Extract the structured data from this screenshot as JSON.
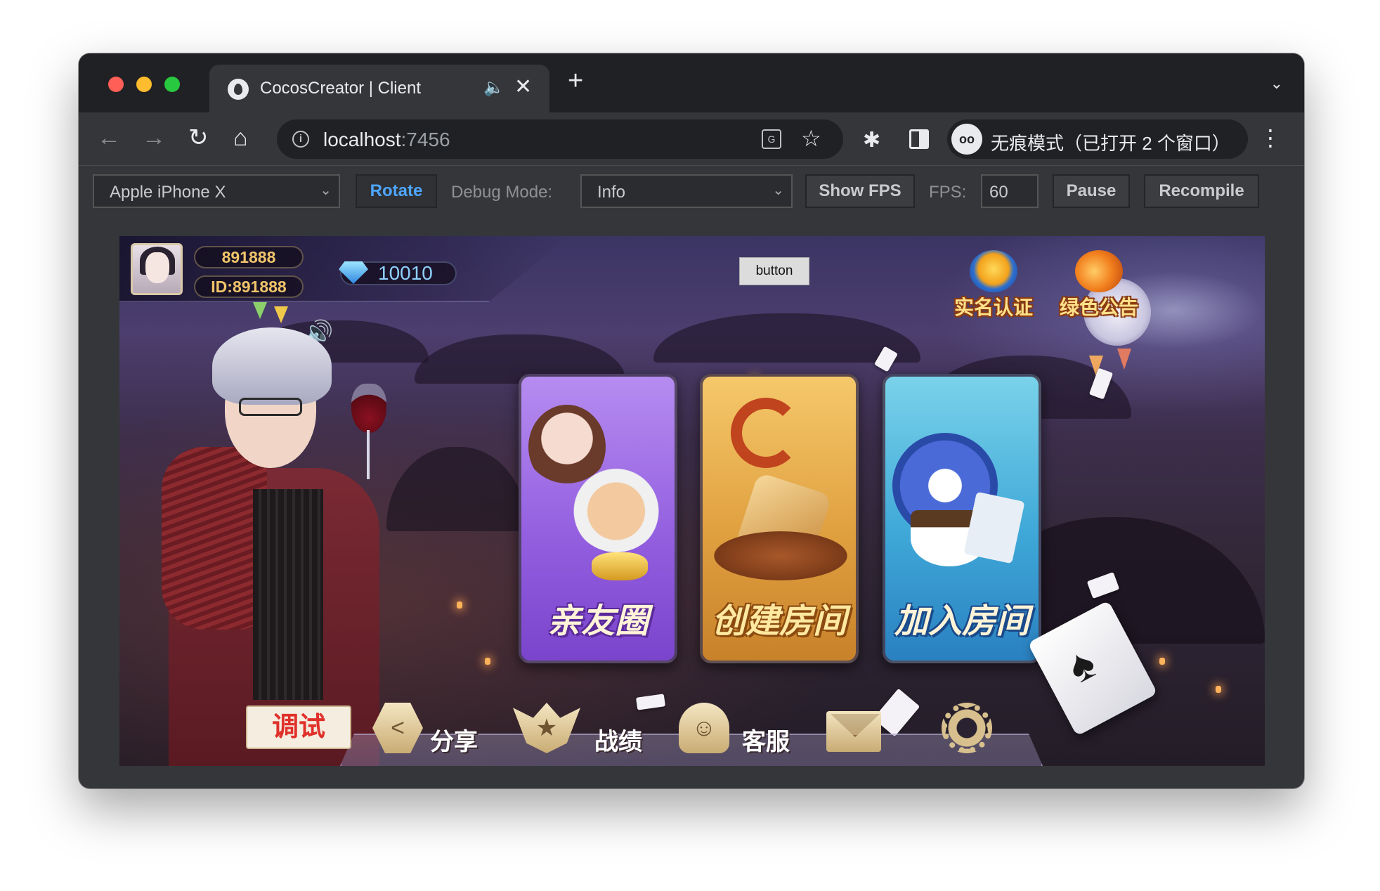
{
  "browser": {
    "tab": {
      "title": "CocosCreator | Client",
      "audio_icon": "speaker-icon",
      "close_glyph": "✕"
    },
    "new_tab_glyph": "+",
    "tab_menu_glyph": "⌄",
    "nav": {
      "back_glyph": "←",
      "forward_glyph": "→",
      "reload_glyph": "↻",
      "home_glyph": "⌂"
    },
    "address": {
      "host": "localhost",
      "port": ":7456"
    },
    "translate_glyph": "G",
    "bookmark_glyph": "☆",
    "extensions_glyph": "✱",
    "incognito_label": "无痕模式（已打开 2 个窗口）",
    "incognito_glyph": "oo",
    "more_glyph": "⋮"
  },
  "devbar": {
    "device_select": "Apple iPhone X",
    "rotate_label": "Rotate",
    "debug_mode_label": "Debug Mode:",
    "debug_mode_value": "Info",
    "show_fps_label": "Show FPS",
    "fps_label": "FPS:",
    "fps_value": "60",
    "pause_label": "Pause",
    "recompile_label": "Recompile",
    "chevron_glyph": "⌄"
  },
  "game": {
    "player": {
      "coins": "891888",
      "id": "ID:891888",
      "diamonds": "10010"
    },
    "sound_glyph": "🔊",
    "debug_button_label": "button",
    "top_icons": [
      {
        "label": "实名认证",
        "icon": "verify-medal-icon"
      },
      {
        "label": "绿色公告",
        "icon": "megaphone-icon"
      }
    ],
    "cards": [
      {
        "label": "亲友圈",
        "color": "#9460e0"
      },
      {
        "label": "创建房间",
        "color": "#e0a040"
      },
      {
        "label": "加入房间",
        "color": "#3fa8d8"
      }
    ],
    "bottom": {
      "debug_label": "调试",
      "share_label": "分享",
      "record_label": "战绩",
      "service_label": "客服",
      "share_glyph": "<",
      "record_glyph": "★",
      "service_glyph": "☺",
      "settings_glyph": "⚙"
    },
    "spade_glyph": "♠"
  }
}
